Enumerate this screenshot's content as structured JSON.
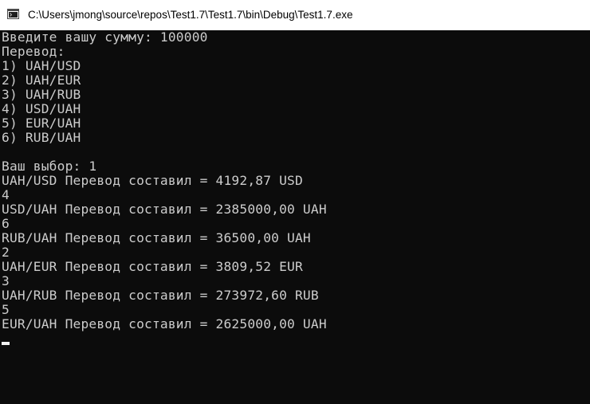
{
  "window": {
    "title": "C:\\Users\\jmong\\source\\repos\\Test1.7\\Test1.7\\bin\\Debug\\Test1.7.exe",
    "icon": "console-app-icon"
  },
  "console": {
    "lines": [
      "Введите вашу сумму: 100000",
      "Перевод:",
      "1) UAH/USD",
      "2) UAH/EUR",
      "3) UAH/RUB",
      "4) USD/UAH",
      "5) EUR/UAH",
      "6) RUB/UAH",
      "",
      "Ваш выбор: 1",
      "UAH/USD Перевод составил = 4192,87 USD",
      "4",
      "USD/UAH Перевод составил = 2385000,00 UAH",
      "6",
      "RUB/UAH Перевод составил = 36500,00 UAH",
      "2",
      "UAH/EUR Перевод составил = 3809,52 EUR",
      "3",
      "UAH/RUB Перевод составил = 273972,60 RUB",
      "5",
      "EUR/UAH Перевод составил = 2625000,00 UAH"
    ]
  },
  "colors": {
    "background": "#0c0c0c",
    "text": "#cccccc",
    "titlebar": "#ffffff",
    "cursor": "#f2f2f2"
  }
}
